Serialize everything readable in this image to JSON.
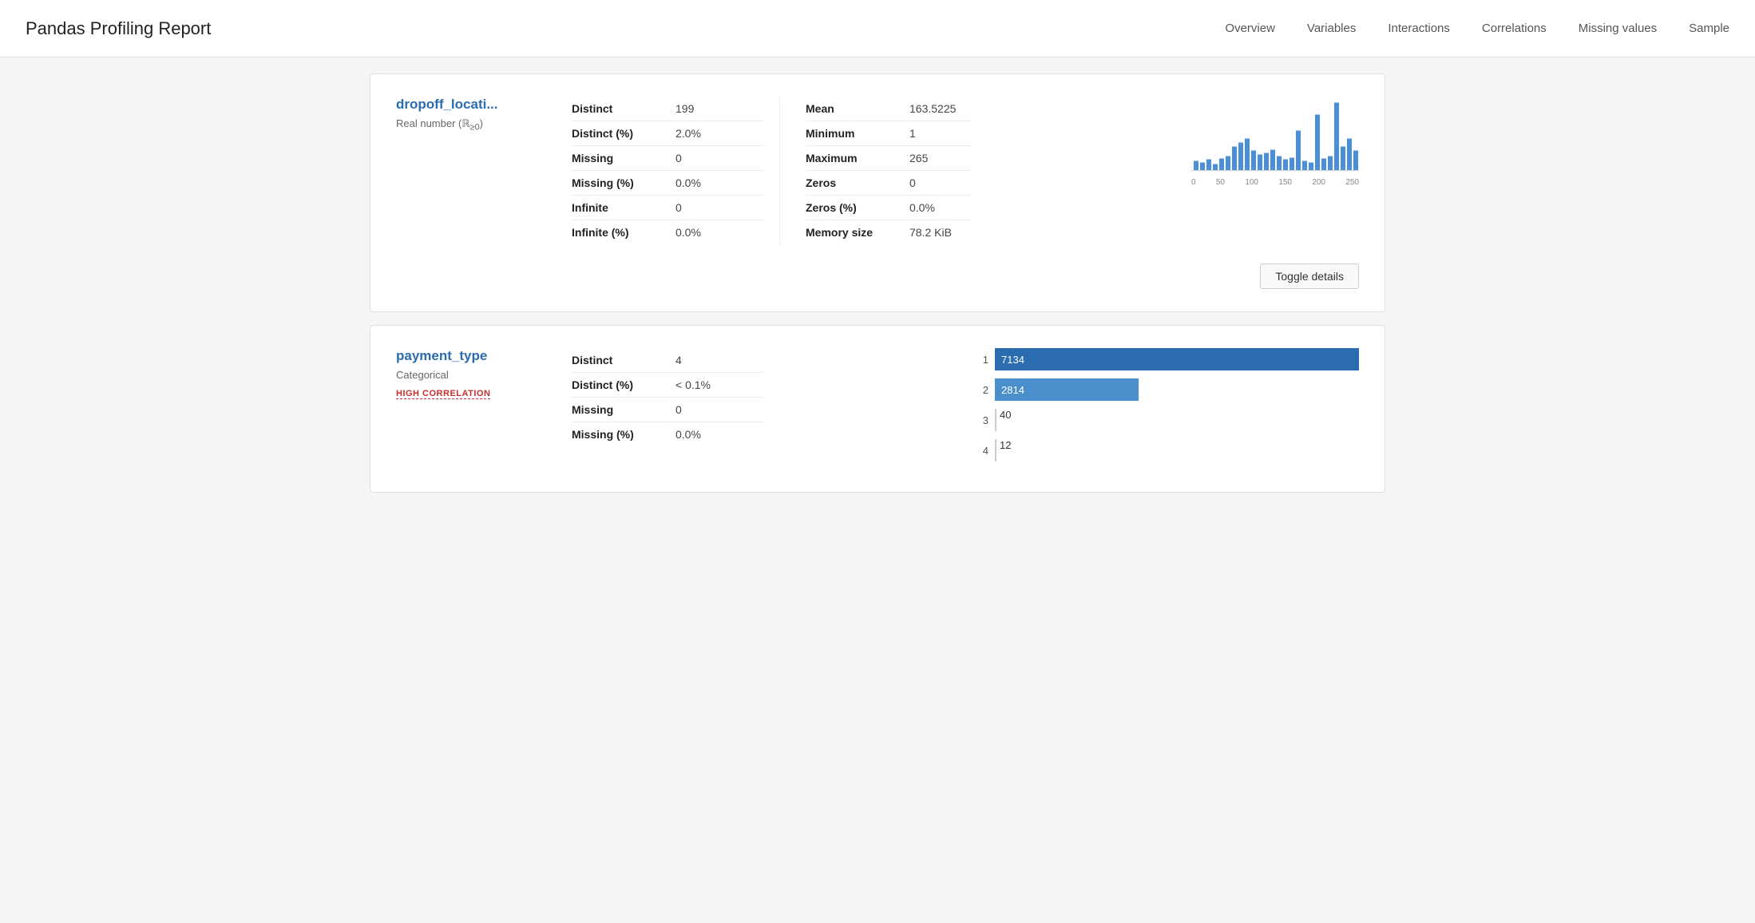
{
  "header": {
    "title": "Pandas Profiling Report",
    "nav": [
      {
        "label": "Overview",
        "id": "overview"
      },
      {
        "label": "Variables",
        "id": "variables"
      },
      {
        "label": "Interactions",
        "id": "interactions"
      },
      {
        "label": "Correlations",
        "id": "correlations"
      },
      {
        "label": "Missing values",
        "id": "missing-values"
      },
      {
        "label": "Sample",
        "id": "sample"
      }
    ]
  },
  "variables": [
    {
      "id": "dropoff_location",
      "name": "dropoff_locati...",
      "type": "Real number (ℝ≥0)",
      "badge": null,
      "stats_left": [
        {
          "label": "Distinct",
          "value": "199"
        },
        {
          "label": "Distinct (%)",
          "value": "2.0%"
        },
        {
          "label": "Missing",
          "value": "0"
        },
        {
          "label": "Missing (%)",
          "value": "0.0%"
        },
        {
          "label": "Infinite",
          "value": "0"
        },
        {
          "label": "Infinite (%)",
          "value": "0.0%"
        }
      ],
      "stats_right": [
        {
          "label": "Mean",
          "value": "163.5225"
        },
        {
          "label": "Minimum",
          "value": "1"
        },
        {
          "label": "Maximum",
          "value": "265"
        },
        {
          "label": "Zeros",
          "value": "0"
        },
        {
          "label": "Zeros (%)",
          "value": "0.0%"
        },
        {
          "label": "Memory size",
          "value": "78.2 KiB"
        }
      ],
      "chart_type": "histogram",
      "histogram_axis": [
        "0",
        "50",
        "100",
        "150",
        "200",
        "250"
      ],
      "toggle_btn": "Toggle details"
    },
    {
      "id": "payment_type",
      "name": "payment_type",
      "type": "Categorical",
      "badge": "HIGH CORRELATION",
      "stats_left": [
        {
          "label": "Distinct",
          "value": "4"
        },
        {
          "label": "Distinct (%)",
          "value": "< 0.1%"
        },
        {
          "label": "Missing",
          "value": "0"
        },
        {
          "label": "Missing (%)",
          "value": "0.0%"
        }
      ],
      "chart_type": "bar",
      "bars": [
        {
          "label": "1",
          "value": 7134,
          "max": 7134,
          "display": "7134"
        },
        {
          "label": "2",
          "value": 2814,
          "max": 7134,
          "display": "2814"
        },
        {
          "label": "3",
          "value": 40,
          "max": 7134,
          "display": "40"
        },
        {
          "label": "4",
          "value": 12,
          "max": 7134,
          "display": "12"
        }
      ]
    }
  ]
}
